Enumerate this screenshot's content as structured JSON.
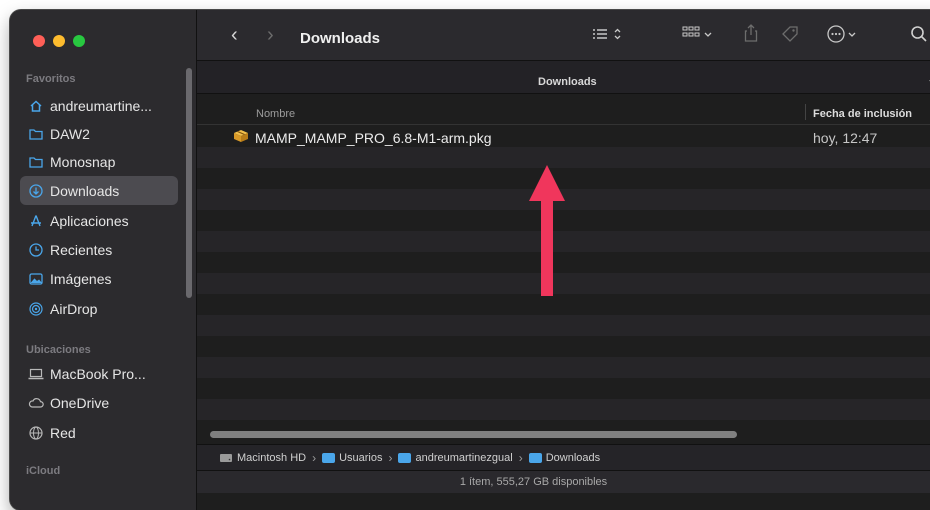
{
  "sidebar": {
    "favorites_title": "Favoritos",
    "locations_title": "Ubicaciones",
    "icloud_title": "iCloud",
    "favorites": [
      {
        "label": "andreumartine...",
        "icon": "home-icon",
        "selected": false
      },
      {
        "label": "DAW2",
        "icon": "folder-icon",
        "selected": false
      },
      {
        "label": "Monosnap",
        "icon": "folder-icon",
        "selected": false
      },
      {
        "label": "Downloads",
        "icon": "download-icon",
        "selected": true
      },
      {
        "label": "Aplicaciones",
        "icon": "applications-icon",
        "selected": false
      },
      {
        "label": "Recientes",
        "icon": "clock-icon",
        "selected": false
      },
      {
        "label": "Imágenes",
        "icon": "images-icon",
        "selected": false
      },
      {
        "label": "AirDrop",
        "icon": "airdrop-icon",
        "selected": false
      }
    ],
    "locations": [
      {
        "label": "MacBook Pro...",
        "icon": "laptop-icon"
      },
      {
        "label": "OneDrive",
        "icon": "cloud-icon"
      },
      {
        "label": "Red",
        "icon": "network-icon"
      }
    ]
  },
  "toolbar": {
    "title": "Downloads"
  },
  "tab": {
    "label": "Downloads"
  },
  "columns": {
    "name": "Nombre",
    "date": "Fecha de inclusión"
  },
  "files": [
    {
      "name": "MAMP_MAMP_PRO_6.8-M1-arm.pkg",
      "date": "hoy, 12:47",
      "icon": "package-icon"
    }
  ],
  "pathbar": {
    "items": [
      "Macintosh HD",
      "Usuarios",
      "andreumartinezgual",
      "Downloads"
    ]
  },
  "status": {
    "text": "1 ítem, 555,27 GB disponibles"
  },
  "colors": {
    "accent": "#4aa6ea",
    "arrow": "#f0365c",
    "selection": "#4c4b50"
  }
}
